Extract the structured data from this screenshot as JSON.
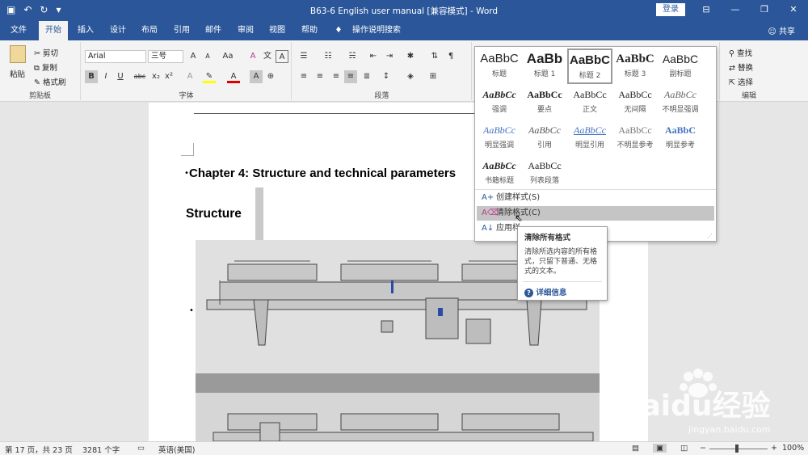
{
  "window": {
    "title": "B63-6 English user manual [兼容模式] - Word",
    "login_label": "登录",
    "share_label": "共享",
    "qat_icons": [
      "save-icon",
      "undo-icon",
      "redo-icon",
      "customize-icon"
    ]
  },
  "tabs": [
    {
      "label": "文件"
    },
    {
      "label": "开始"
    },
    {
      "label": "插入"
    },
    {
      "label": "设计"
    },
    {
      "label": "布局"
    },
    {
      "label": "引用"
    },
    {
      "label": "邮件"
    },
    {
      "label": "审阅"
    },
    {
      "label": "视图"
    },
    {
      "label": "帮助"
    },
    {
      "label": "操作说明搜索"
    }
  ],
  "ribbon": {
    "clipboard": {
      "label": "剪贴板",
      "paste": "粘贴",
      "cut": "剪切",
      "copy": "复制",
      "format_painter": "格式刷"
    },
    "font": {
      "label": "字体",
      "font_name": "Arial",
      "font_size": "三号",
      "change_case": "Aa"
    },
    "paragraph": {
      "label": "段落"
    },
    "editing": {
      "label": "编辑",
      "find": "查找",
      "replace": "替换",
      "select": "选择"
    }
  },
  "document": {
    "heading1": "Chapter 4: Structure and technical parameters",
    "heading2": "Structure"
  },
  "styles_gallery": {
    "items": [
      {
        "preview": "AaBbC",
        "name": "标题"
      },
      {
        "preview": "AaBb",
        "name": "标题 1"
      },
      {
        "preview": "AaBbC",
        "name": "标题 2"
      },
      {
        "preview": "AaBbC",
        "name": "标题 3"
      },
      {
        "preview": "AaBbC",
        "name": "副标题"
      },
      {
        "preview": "AaBbCc",
        "name": "强调"
      },
      {
        "preview": "AaBbCc",
        "name": "要点"
      },
      {
        "preview": "AaBbCc",
        "name": "正文"
      },
      {
        "preview": "AaBbCc",
        "name": "无间隔"
      },
      {
        "preview": "AaBbCc",
        "name": "不明显强调"
      },
      {
        "preview": "AaBbCc",
        "name": "明显强调"
      },
      {
        "preview": "AaBbCc",
        "name": "引用"
      },
      {
        "preview": "AaBbCc",
        "name": "明显引用"
      },
      {
        "preview": "AaBbCc",
        "name": "不明显参考"
      },
      {
        "preview": "AaBbC",
        "name": "明显参考"
      },
      {
        "preview": "AaBbCc",
        "name": "书籍标题"
      },
      {
        "preview": "AaBbCc",
        "name": "列表段落"
      }
    ],
    "selected_index": 2,
    "menu": [
      {
        "label": "创建样式(S)",
        "icon": "create-style-icon"
      },
      {
        "label": "清除格式(C)",
        "icon": "clear-formatting-icon"
      },
      {
        "label": "应用样",
        "icon": "apply-styles-icon"
      }
    ]
  },
  "tooltip": {
    "title": "清除所有格式",
    "description": "清除所选内容的所有格式，只留下普通、无格式的文本。",
    "help": "详细信息"
  },
  "status": {
    "page": "第 17 页，共 23 页",
    "words": "3281 个字",
    "language": "英语(美国)",
    "zoom": "100%"
  },
  "watermark": {
    "text": "Baidu经验",
    "sub": "jingyan.baidu.com"
  },
  "colors": {
    "accent": "#2b579a",
    "highlight": "#ffff00",
    "font_color": "#e00000"
  }
}
